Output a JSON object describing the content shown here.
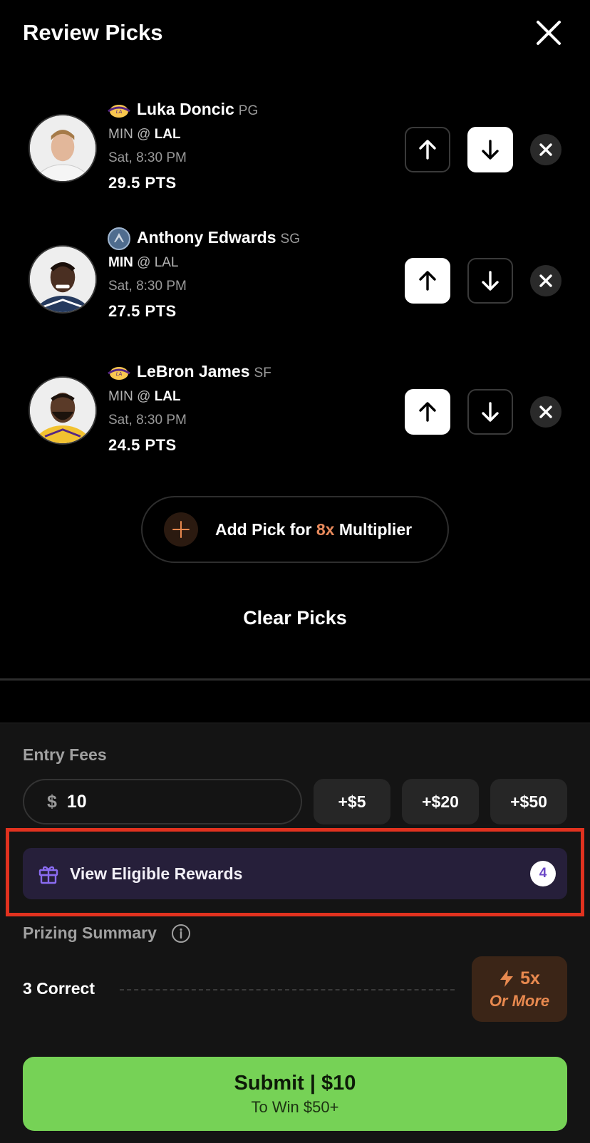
{
  "header": {
    "title": "Review Picks",
    "close_icon": "close-icon"
  },
  "picks": [
    {
      "player": "Luka Doncic",
      "position": "PG",
      "away": "MIN",
      "at": "@",
      "home": "LAL",
      "bold_team": "home",
      "time": "Sat, 8:30 PM",
      "line": "29.5 PTS",
      "selection": "down",
      "team_logo": "lakers-logo"
    },
    {
      "player": "Anthony Edwards",
      "position": "SG",
      "away": "MIN",
      "at": "@",
      "home": "LAL",
      "bold_team": "away",
      "time": "Sat, 8:30 PM",
      "line": "27.5 PTS",
      "selection": "up",
      "team_logo": "timberwolves-logo"
    },
    {
      "player": "LeBron James",
      "position": "SF",
      "away": "MIN",
      "at": "@",
      "home": "LAL",
      "bold_team": "home",
      "time": "Sat, 8:30 PM",
      "line": "24.5 PTS",
      "selection": "up",
      "team_logo": "lakers-logo"
    }
  ],
  "add_pick": {
    "prefix": "Add Pick for ",
    "multiplier": "8x",
    "suffix": " Multiplier"
  },
  "clear_picks": "Clear Picks",
  "entry": {
    "label": "Entry Fees",
    "currency": "$",
    "value": "10",
    "chips": [
      "+$5",
      "+$20",
      "+$50"
    ]
  },
  "rewards": {
    "label": "View Eligible Rewards",
    "count": "4"
  },
  "prizing": {
    "label": "Prizing Summary",
    "tiers": [
      {
        "label": "3 Correct",
        "multiplier": "5x",
        "note": "Or More"
      }
    ]
  },
  "submit": {
    "label": "Submit | $10",
    "sub": "To Win $50+"
  },
  "colors": {
    "accent_orange": "#e8894f",
    "submit_green": "#76d256",
    "rewards_purple": "#261f3a",
    "highlight_red": "#e2321f"
  }
}
